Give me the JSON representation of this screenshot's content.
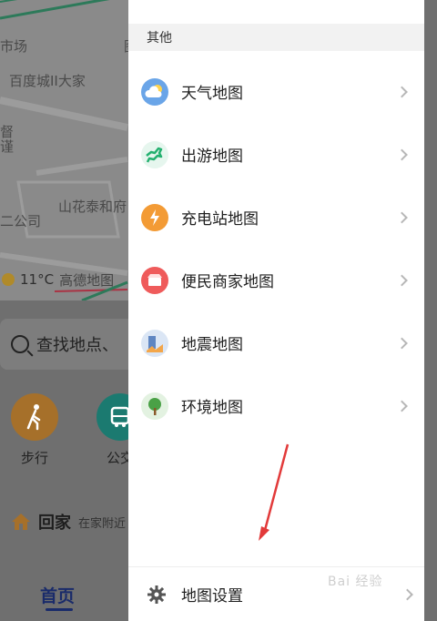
{
  "background": {
    "map_labels": [
      "市场",
      "百度城II大家",
      "二公司",
      "山花泰和府",
      "图",
      "督",
      "谨"
    ],
    "weather": {
      "temp": "11°C",
      "brand": "高德地图"
    },
    "search_placeholder": "查找地点、",
    "shortcuts": [
      {
        "label": "步行",
        "icon": "walk-icon",
        "color": "#a6702a"
      },
      {
        "label": "公交",
        "icon": "bus-icon",
        "color": "#1b7a70"
      }
    ],
    "home": {
      "title": "回家",
      "subtitle": "在家附近"
    },
    "bottom_tab": "首页"
  },
  "drawer": {
    "section_title": "其他",
    "items": [
      {
        "label": "天气地图",
        "icon": "weather-cloud-icon",
        "color": "#6aa5e8"
      },
      {
        "label": "出游地图",
        "icon": "horse-travel-icon",
        "color": "#23b06f"
      },
      {
        "label": "充电站地图",
        "icon": "charging-station-icon",
        "color": "#f39b35"
      },
      {
        "label": "便民商家地图",
        "icon": "shop-pin-icon",
        "color": "#ef5b5b"
      },
      {
        "label": "地震地图",
        "icon": "earthquake-icon",
        "color": "#5f86c2"
      },
      {
        "label": "环境地图",
        "icon": "tree-icon",
        "color": "#4aa146"
      }
    ],
    "settings_label": "地图设置"
  },
  "watermark": "Bai 经验"
}
